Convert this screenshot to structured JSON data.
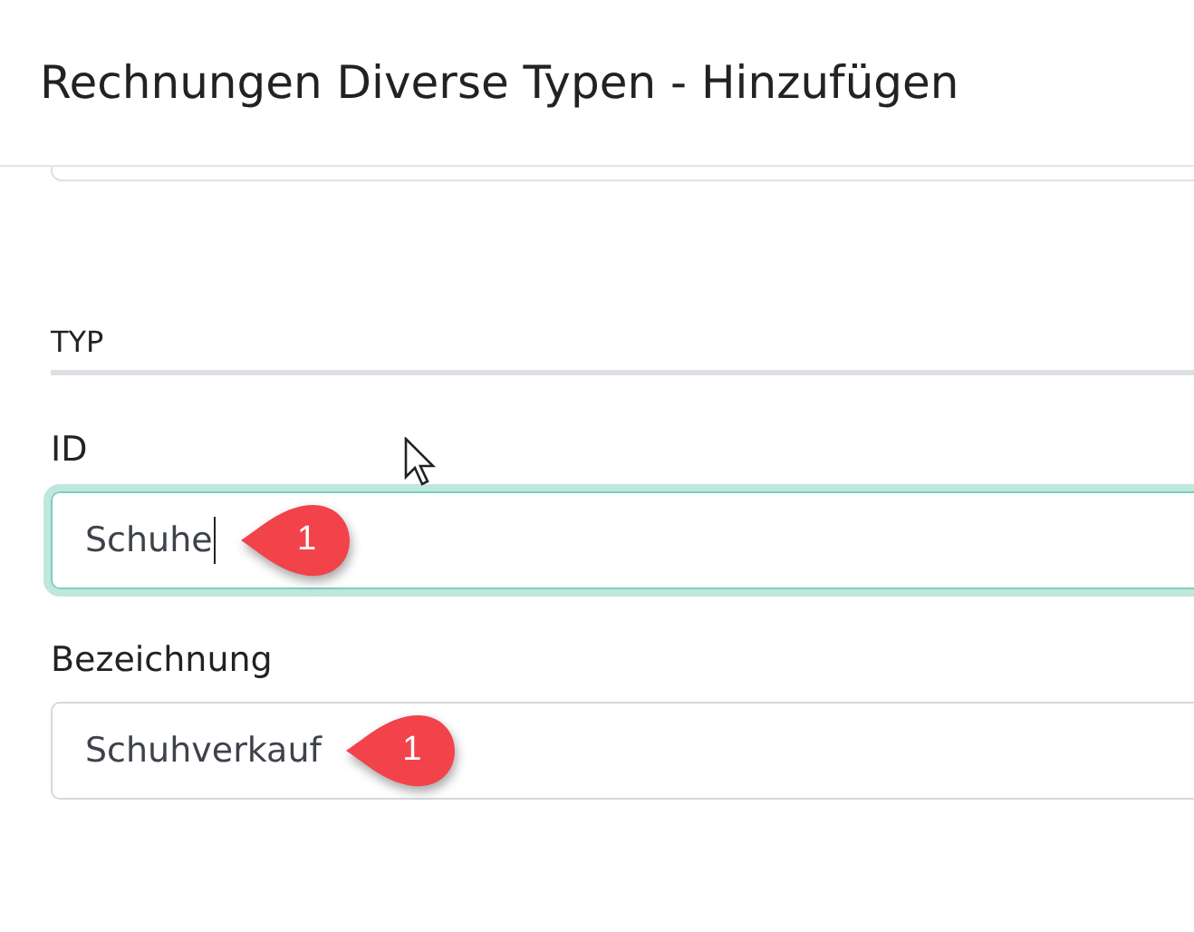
{
  "window": {
    "title": "Rechnungen Diverse Typen - Hinzufügen"
  },
  "section": {
    "title": "TYP"
  },
  "fields": [
    {
      "label": "ID",
      "value": "Schuhe",
      "focused": true,
      "callout": "1"
    },
    {
      "label": "Bezeichnung",
      "value": "Schuhverkauf",
      "focused": false,
      "callout": "1"
    }
  ]
}
